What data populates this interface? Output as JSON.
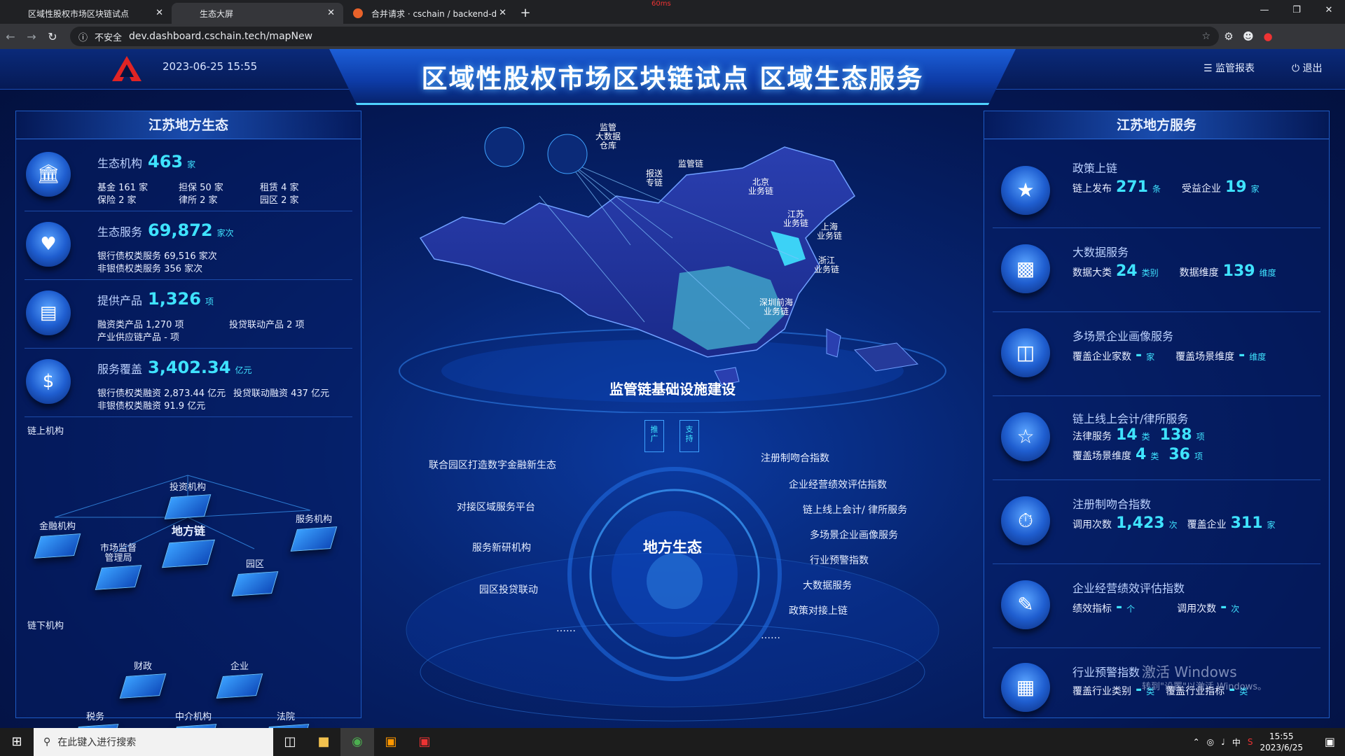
{
  "browser": {
    "tabs": [
      {
        "label": "区域性股权市场区块链试点",
        "close": "✕"
      },
      {
        "label": "生态大屏",
        "close": "✕"
      },
      {
        "label": "合并请求 · cschain / backend-d",
        "close": "✕"
      }
    ],
    "new_tab": "+",
    "security_label": "不安全",
    "url": "dev.dashboard.cschain.tech/mapNew",
    "network_badge": "60ms"
  },
  "header": {
    "datetime": "2023-06-25 15:55",
    "title": "区域性股权市场区块链试点  区域生态服务",
    "report_link": "监管报表",
    "logout_link": "退出"
  },
  "left_panel": {
    "title": "江苏地方生态",
    "stats": [
      {
        "name": "生态机构",
        "value": "463",
        "unit": "家",
        "lines": [
          "基金 161 家",
          "担保 50 家",
          "租赁 4 家",
          "保险 2 家",
          "律所 2 家",
          "园区 2 家"
        ]
      },
      {
        "name": "生态服务",
        "value": "69,872",
        "unit": "家次",
        "lines": [
          "银行债权类服务 69,516 家次",
          "非银债权类服务 356 家次"
        ]
      },
      {
        "name": "提供产品",
        "value": "1,326",
        "unit": "项",
        "lines": [
          "融资类产品 1,270 项",
          "投贷联动产品 2 项",
          "产业供应链产品 - 项"
        ]
      },
      {
        "name": "服务覆盖",
        "value": "3,402.34",
        "unit": "亿元",
        "lines": [
          "银行债权类融资 2,873.44 亿元",
          "投贷联动融资 437 亿元",
          "非银债权类融资 91.9 亿元"
        ]
      }
    ],
    "chain_upper": "链上机构",
    "chain_lower": "链下机构",
    "nodes_upper": {
      "center": "地方链",
      "invest": "投资机构",
      "finance": "金融机构",
      "service": "服务机构",
      "market": "市场监督\n管理局",
      "park": "园区"
    },
    "nodes_lower": {
      "finance_dept": "财政",
      "enterprise": "企业",
      "tax": "税务",
      "agency": "中介机构",
      "court": "法院"
    }
  },
  "center": {
    "map_labels": {
      "regulatory_warehouse": "监管\n大数据\n仓库",
      "regulatory_chain": "监管链",
      "report_chain": "报送\n专链",
      "beijing": "北京\n业务链",
      "jiangsu": "江苏\n业务链",
      "shanghai": "上海\n业务链",
      "zhejiang": "浙江\n业务链",
      "shenzhen": "深圳前海\n业务链"
    },
    "infra_title": "监管链基础设施建设",
    "push_label": "推\n广",
    "support_label": "支\n持",
    "eco_title": "地方生态",
    "left_labels": [
      "联合园区打造数字金融新生态",
      "对接区域服务平台",
      "服务新研机构",
      "园区投贷联动",
      "……"
    ],
    "right_labels": [
      "注册制吻合指数",
      "企业经营绩效评估指数",
      "链上线上会计/ 律所服务",
      "多场景企业画像服务",
      "行业预警指数",
      "大数据服务",
      "政策对接上链",
      "……"
    ]
  },
  "right_panel": {
    "title": "江苏地方服务",
    "items": [
      {
        "name": "政策上链",
        "row1": [
          [
            "链上发布",
            "271",
            "条"
          ],
          [
            "受益企业",
            "19",
            "家"
          ]
        ]
      },
      {
        "name": "大数据服务",
        "row1": [
          [
            "数据大类",
            "24",
            "类别"
          ],
          [
            "数据维度",
            "139",
            "维度"
          ]
        ]
      },
      {
        "name": "多场景企业画像服务",
        "row1": [
          [
            "覆盖企业家数",
            "-",
            "家"
          ],
          [
            "覆盖场景维度",
            "-",
            "维度"
          ]
        ]
      },
      {
        "name": "链上线上会计/律所服务",
        "row1": [
          [
            "法律服务",
            "14",
            "类"
          ],
          [
            "",
            "138",
            "项"
          ]
        ],
        "row2": [
          [
            "覆盖场景维度",
            "4",
            "类"
          ],
          [
            "",
            "36",
            "项"
          ]
        ]
      },
      {
        "name": "注册制吻合指数",
        "row1": [
          [
            "调用次数",
            "1,423",
            "次"
          ],
          [
            "覆盖企业",
            "311",
            "家"
          ]
        ]
      },
      {
        "name": "企业经营绩效评估指数",
        "row1": [
          [
            "绩效指标",
            "-",
            "个"
          ],
          [
            "调用次数",
            "-",
            "次"
          ]
        ]
      },
      {
        "name": "行业预警指数",
        "row1": [
          [
            "覆盖行业类别",
            "-",
            "类"
          ],
          [
            "覆盖行业指标",
            "-",
            "类"
          ]
        ]
      }
    ]
  },
  "watermark": {
    "line1": "激活 Windows",
    "line2": "转到\"设置\"以激活 Windows。"
  },
  "taskbar": {
    "search_placeholder": "在此键入进行搜索",
    "ime": "中",
    "time": "15:55",
    "date": "2023/6/25"
  }
}
